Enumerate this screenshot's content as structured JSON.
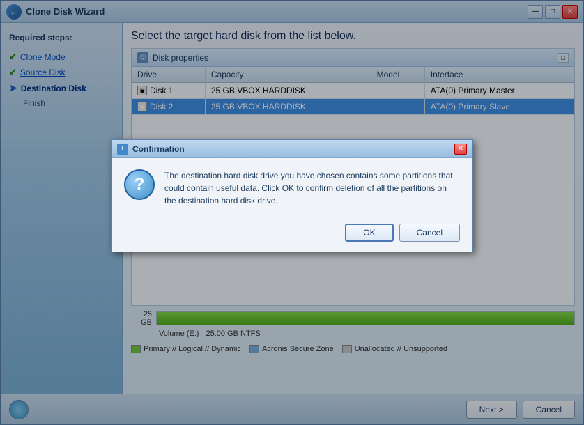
{
  "window": {
    "title": "Clone Disk Wizard",
    "minimize_label": "—",
    "maximize_label": "□",
    "close_label": "✕"
  },
  "sidebar": {
    "required_label": "Required steps:",
    "items": [
      {
        "label": "Clone Mode",
        "state": "done"
      },
      {
        "label": "Source Disk",
        "state": "done"
      },
      {
        "label": "Destination Disk",
        "state": "active"
      },
      {
        "label": "Finish",
        "state": "normal"
      }
    ]
  },
  "panel": {
    "title": "Select the target hard disk from the list below.",
    "disk_properties_label": "Disk properties",
    "expand_label": "□"
  },
  "table": {
    "headers": [
      "Drive",
      "Capacity",
      "Model",
      "Interface"
    ],
    "rows": [
      {
        "drive": "Disk 1",
        "capacity": "25 GB",
        "model": "VBOX HARDDISK",
        "interface": "ATA(0) Primary Master",
        "selected": false
      },
      {
        "drive": "Disk 2",
        "capacity": "25 GB",
        "model": "VBOX HARDDISK",
        "interface": "ATA(0) Primary Slave",
        "selected": true
      }
    ]
  },
  "disk_visual": {
    "size_label": "25 GB",
    "volume_label": "Volume (E:)",
    "volume_size": "25.00 GB  NTFS",
    "bar_fill_pct": 100
  },
  "legend": {
    "items": [
      {
        "label": "Primary // Logical // Dynamic",
        "color": "#70c840"
      },
      {
        "label": "Acronis Secure Zone",
        "color": "#7ab0e0"
      },
      {
        "label": "Unallocated // Unsupported",
        "color": "#c8c8c8"
      }
    ]
  },
  "bottom_bar": {
    "next_label": "Next >",
    "cancel_label": "Cancel"
  },
  "modal": {
    "title": "Confirmation",
    "close_label": "✕",
    "message": "The destination hard disk drive you have chosen contains some partitions that could contain useful data. Click OK to confirm deletion of all the partitions on the destination hard disk drive.",
    "ok_label": "OK",
    "cancel_label": "Cancel"
  }
}
